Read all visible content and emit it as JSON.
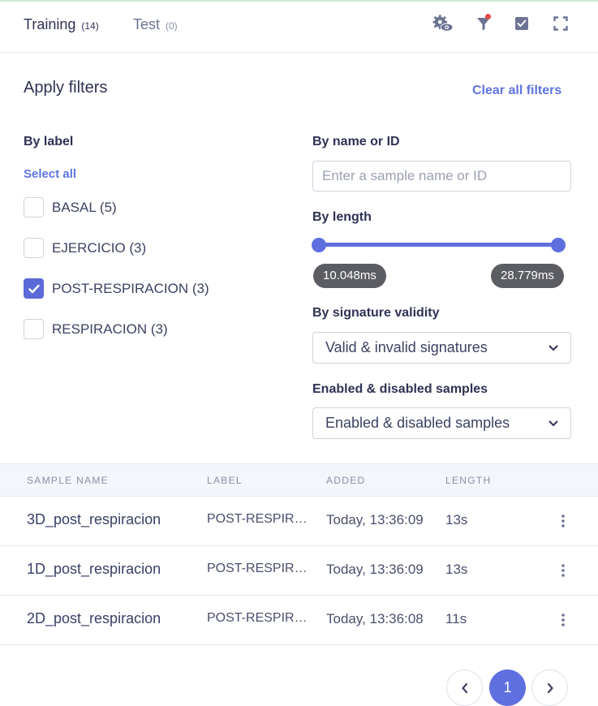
{
  "tabs": {
    "training": {
      "label": "Training",
      "count": "(14)"
    },
    "test": {
      "label": "Test",
      "count": "(0)"
    }
  },
  "header_icons": [
    "settings-eye-icon",
    "filter-icon",
    "checkbox-icon",
    "fullscreen-icon"
  ],
  "filters": {
    "title": "Apply filters",
    "clear_all": "Clear all filters",
    "by_label": {
      "title": "By label",
      "select_all": "Select all",
      "options": [
        {
          "label": "BASAL (5)",
          "checked": false
        },
        {
          "label": "EJERCICIO (3)",
          "checked": false
        },
        {
          "label": "POST-RESPIRACION (3)",
          "checked": true
        },
        {
          "label": "RESPIRACION (3)",
          "checked": false
        }
      ]
    },
    "by_name": {
      "title": "By name or ID",
      "placeholder": "Enter a sample name or ID",
      "value": ""
    },
    "by_length": {
      "title": "By length",
      "min": "10.048ms",
      "max": "28.779ms"
    },
    "by_signature": {
      "title": "By signature validity",
      "selected": "Valid & invalid signatures"
    },
    "enabled": {
      "title": "Enabled & disabled samples",
      "selected": "Enabled & disabled samples"
    }
  },
  "table": {
    "headers": [
      "SAMPLE NAME",
      "LABEL",
      "ADDED",
      "LENGTH"
    ],
    "rows": [
      {
        "name": "3D_post_respiracion",
        "label": "POST-RESPIRACION",
        "added": "Today, 13:36:09",
        "length": "13s"
      },
      {
        "name": "1D_post_respiracion",
        "label": "POST-RESPIRACION",
        "added": "Today, 13:36:09",
        "length": "13s"
      },
      {
        "name": "2D_post_respiracion",
        "label": "POST-RESPIRACION",
        "added": "Today, 13:36:08",
        "length": "11s"
      }
    ]
  },
  "pagination": {
    "current_page": "1"
  },
  "colors": {
    "accent": "#5f6fe0",
    "text": "#2f3254",
    "muted": "#8a90a8",
    "tooltip": "#5b5d63"
  }
}
